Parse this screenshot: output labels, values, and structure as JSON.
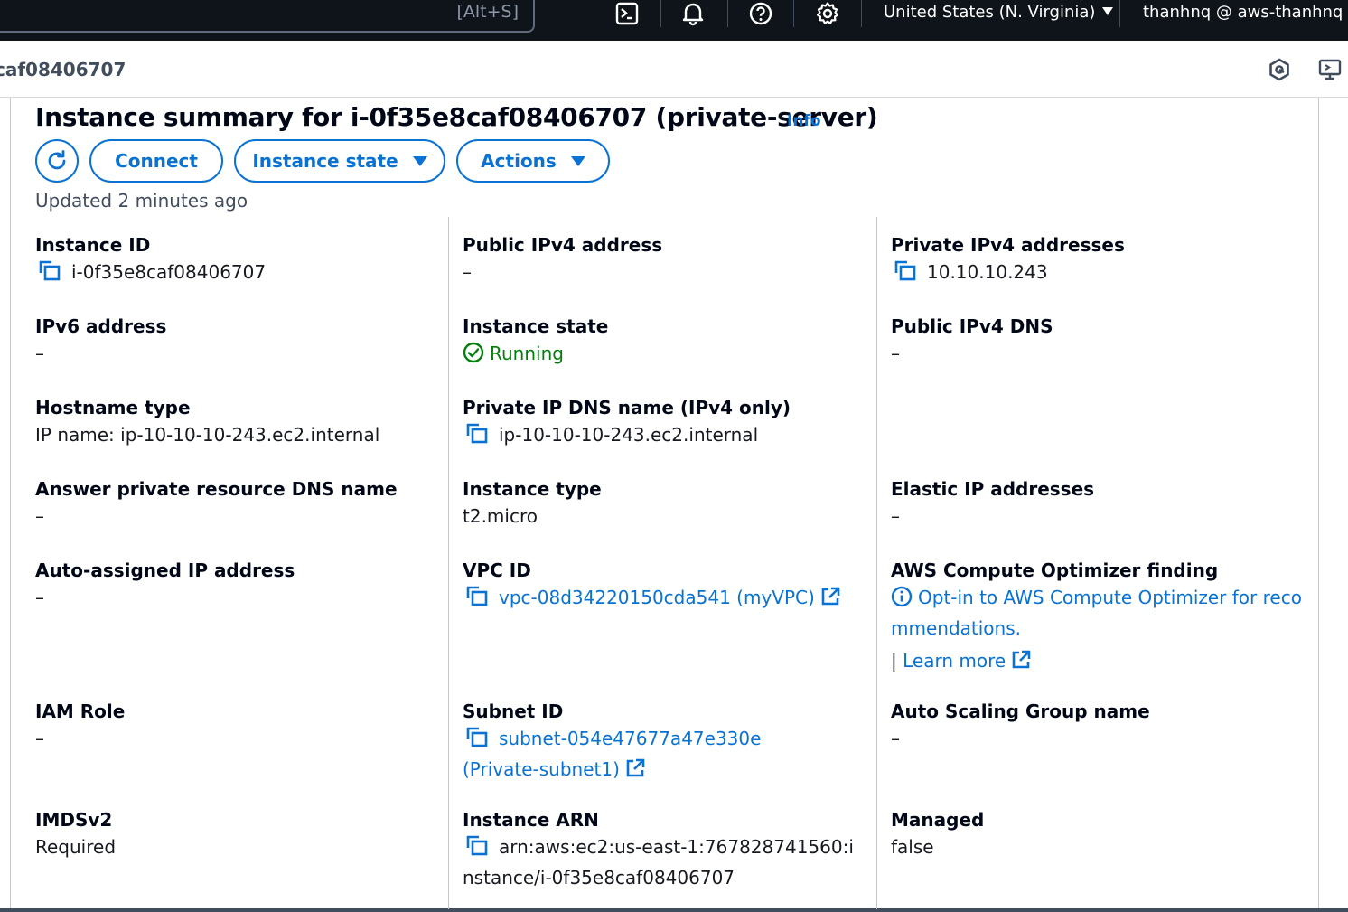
{
  "topnav": {
    "search_shortcut": "[Alt+S]",
    "region": "United States (N. Virginia)",
    "account": "thanhnq @ aws-thanhnq",
    "icons": [
      "cloudshell-icon",
      "bell-icon",
      "help-icon",
      "gear-icon"
    ]
  },
  "breadcrumb": {
    "text": "caf08406707"
  },
  "header": {
    "title": "Instance summary for i-0f35e8caf08406707 (private-server)",
    "info": "Info",
    "updated": "Updated 2 minutes ago"
  },
  "buttons": {
    "connect": "Connect",
    "instance_state": "Instance state",
    "actions": "Actions"
  },
  "fields": {
    "instance_id": {
      "label": "Instance ID",
      "value": "i-0f35e8caf08406707"
    },
    "public_ipv4": {
      "label": "Public IPv4 address",
      "value": "–"
    },
    "private_ipv4": {
      "label": "Private IPv4 addresses",
      "value": "10.10.10.243"
    },
    "ipv6": {
      "label": "IPv6 address",
      "value": "–"
    },
    "instance_state": {
      "label": "Instance state",
      "value": "Running"
    },
    "public_dns": {
      "label": "Public IPv4 DNS",
      "value": "–"
    },
    "hostname_type": {
      "label": "Hostname type",
      "value": "IP name: ip-10-10-10-243.ec2.internal"
    },
    "private_dns": {
      "label": "Private IP DNS name (IPv4 only)",
      "value": "ip-10-10-10-243.ec2.internal"
    },
    "answer_dns": {
      "label": "Answer private resource DNS name",
      "value": "–"
    },
    "instance_type": {
      "label": "Instance type",
      "value": "t2.micro"
    },
    "elastic_ip": {
      "label": "Elastic IP addresses",
      "value": "–"
    },
    "auto_ip": {
      "label": "Auto-assigned IP address",
      "value": "–"
    },
    "vpc_id": {
      "label": "VPC ID",
      "value": "vpc-08d34220150cda541 (myVPC)"
    },
    "optimizer": {
      "label": "AWS Compute Optimizer finding",
      "value": "Opt-in to AWS Compute Optimizer for reco mmendations.",
      "learn_more": "Learn more",
      "separator": "|"
    },
    "iam_role": {
      "label": "IAM Role",
      "value": "–"
    },
    "subnet_id": {
      "label": "Subnet ID",
      "value": "subnet-054e47677a47e330e (Private-subnet1)"
    },
    "asg_name": {
      "label": "Auto Scaling Group name",
      "value": "–"
    },
    "imdsv2": {
      "label": "IMDSv2",
      "value": "Required"
    },
    "instance_arn": {
      "label": "Instance ARN",
      "value": "arn:aws:ec2:us-east-1:767828741560:instance/i-0f35e8caf08406707"
    },
    "managed": {
      "label": "Managed",
      "value": "false"
    }
  },
  "colors": {
    "link": "#0972d3",
    "success": "#037f0c",
    "nav_bg": "#0f141a"
  }
}
